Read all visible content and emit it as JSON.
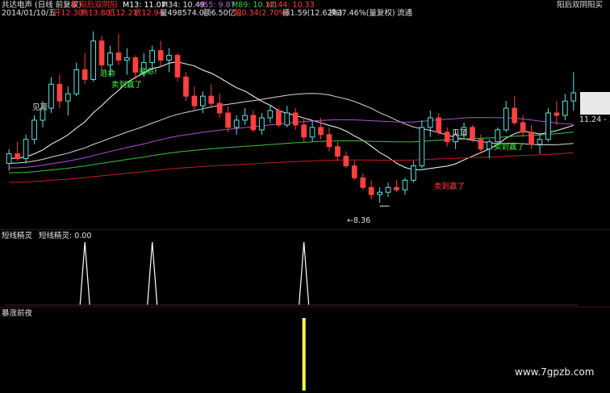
{
  "header": {
    "title": "共达电声 (日线 前复权)",
    "marker": "▼",
    "indicator": "阳后双阴阳",
    "m13": "M13: 11.07",
    "m34": "M34: 10.49",
    "m55": "M55: 9.87",
    "m89": "M89: 10.12",
    "m144": "M144: 10.33",
    "right_label": "阳后双阴阳买"
  },
  "info": {
    "date": "2014/01/10/五",
    "open": "开12.30",
    "high": "高13.80",
    "low": "低12.21",
    "close": "收12.94",
    "volume": "量498574.0",
    "amount": "额6.50亿",
    "change": "幅0.34(2.70%)",
    "amp": "振1.59(12.62%)",
    "turnover": "换37.46%(量复权)",
    "extra": "流通"
  },
  "annotations": {
    "jianding1": "见顶",
    "jianding2": "见顶",
    "taoming1": "逃命",
    "taoming2": "逃命!",
    "sell1": "卖到赢了",
    "sell2": "卖到赢了",
    "buy": "卖到赢了",
    "low_label": "←8.36",
    "price_right": "11.24 - 1"
  },
  "panel2": {
    "name": "短线精灵",
    "label": "短线精灵: 0.00"
  },
  "panel3": {
    "name": "暴涨前夜"
  },
  "watermark": "www.7gpzb.com",
  "colors": {
    "up": "#5fe0e0",
    "down": "#ff4040",
    "ma13": "#ffffff",
    "ma34": "#d8d8d8",
    "ma55": "#b050d0",
    "ma89": "#40c040",
    "ma144": "#c02020",
    "signal": "#ffffff",
    "bar": "#ffff40"
  },
  "chart_data": {
    "type": "candlestick",
    "candles_ohlc": [
      [
        10.0,
        10.6,
        9.7,
        10.4
      ],
      [
        10.4,
        10.9,
        10.1,
        10.2
      ],
      [
        10.2,
        11.2,
        10.0,
        11.0
      ],
      [
        11.0,
        12.0,
        10.8,
        11.8
      ],
      [
        11.8,
        12.6,
        11.5,
        12.3
      ],
      [
        12.3,
        13.6,
        12.1,
        13.3
      ],
      [
        13.3,
        13.7,
        12.3,
        12.6
      ],
      [
        12.6,
        13.2,
        12.0,
        12.9
      ],
      [
        12.9,
        14.2,
        12.8,
        13.9
      ],
      [
        13.9,
        14.6,
        13.3,
        13.5
      ],
      [
        13.5,
        15.5,
        13.4,
        15.1
      ],
      [
        15.1,
        15.3,
        13.8,
        14.1
      ],
      [
        14.1,
        14.9,
        13.6,
        14.6
      ],
      [
        14.6,
        15.4,
        14.1,
        14.3
      ],
      [
        14.3,
        14.8,
        13.7,
        14.4
      ],
      [
        14.4,
        14.5,
        13.5,
        13.8
      ],
      [
        13.8,
        14.6,
        13.6,
        14.2
      ],
      [
        14.2,
        14.9,
        13.9,
        14.7
      ],
      [
        14.7,
        15.1,
        14.0,
        14.3
      ],
      [
        14.3,
        14.8,
        13.8,
        14.5
      ],
      [
        14.5,
        14.6,
        13.4,
        13.6
      ],
      [
        13.6,
        13.8,
        12.6,
        12.8
      ],
      [
        12.8,
        13.2,
        12.2,
        12.4
      ],
      [
        12.4,
        13.0,
        12.1,
        12.8
      ],
      [
        12.8,
        13.3,
        12.3,
        12.5
      ],
      [
        12.5,
        12.9,
        11.9,
        12.1
      ],
      [
        12.1,
        12.4,
        11.3,
        11.5
      ],
      [
        11.5,
        12.0,
        11.2,
        11.8
      ],
      [
        11.8,
        12.3,
        11.6,
        12.0
      ],
      [
        12.0,
        12.2,
        11.3,
        11.4
      ],
      [
        11.4,
        12.1,
        11.2,
        11.9
      ],
      [
        11.9,
        12.4,
        11.7,
        12.2
      ],
      [
        12.2,
        12.3,
        11.5,
        11.6
      ],
      [
        11.6,
        12.4,
        11.5,
        12.1
      ],
      [
        12.1,
        12.3,
        11.4,
        11.6
      ],
      [
        11.6,
        11.9,
        10.9,
        11.1
      ],
      [
        11.1,
        11.8,
        10.9,
        11.5
      ],
      [
        11.5,
        11.9,
        11.0,
        11.2
      ],
      [
        11.2,
        11.5,
        10.5,
        10.7
      ],
      [
        10.7,
        10.9,
        10.1,
        10.3
      ],
      [
        10.3,
        10.5,
        9.8,
        9.9
      ],
      [
        9.9,
        10.1,
        9.3,
        9.4
      ],
      [
        9.4,
        9.6,
        8.9,
        9.0
      ],
      [
        9.0,
        9.3,
        8.5,
        8.7
      ],
      [
        8.7,
        9.0,
        8.36,
        8.8
      ],
      [
        8.8,
        9.2,
        8.6,
        9.0
      ],
      [
        9.0,
        9.3,
        8.8,
        8.9
      ],
      [
        8.9,
        9.4,
        8.7,
        9.3
      ],
      [
        9.3,
        10.1,
        9.2,
        9.9
      ],
      [
        9.9,
        11.8,
        9.8,
        11.5
      ],
      [
        11.5,
        12.2,
        11.1,
        11.9
      ],
      [
        11.9,
        12.1,
        11.2,
        11.3
      ],
      [
        11.3,
        11.5,
        10.7,
        10.9
      ],
      [
        10.9,
        11.4,
        10.6,
        11.2
      ],
      [
        11.2,
        11.7,
        11.0,
        11.5
      ],
      [
        11.5,
        11.6,
        10.9,
        11.0
      ],
      [
        11.0,
        11.2,
        10.5,
        10.6
      ],
      [
        10.6,
        11.0,
        10.2,
        10.9
      ],
      [
        10.9,
        11.5,
        10.8,
        11.4
      ],
      [
        11.4,
        12.6,
        11.3,
        12.3
      ],
      [
        12.3,
        12.8,
        11.6,
        11.7
      ],
      [
        11.7,
        12.0,
        11.1,
        11.3
      ],
      [
        11.3,
        11.6,
        10.6,
        10.8
      ],
      [
        10.8,
        11.2,
        10.4,
        11.0
      ],
      [
        11.0,
        12.3,
        10.9,
        12.1
      ],
      [
        12.1,
        12.6,
        11.6,
        12.0
      ],
      [
        12.0,
        12.9,
        11.8,
        12.6
      ],
      [
        12.6,
        13.8,
        12.2,
        12.94
      ]
    ],
    "ma_names": [
      "M13",
      "M34",
      "M55",
      "M89",
      "M144"
    ],
    "low_marker": 8.36,
    "signal_spikes": [
      {
        "index": 9,
        "value": 1
      },
      {
        "index": 17,
        "value": 1
      },
      {
        "index": 35,
        "value": 1
      }
    ],
    "bar_signal": [
      {
        "index": 35,
        "value": 1
      }
    ]
  }
}
